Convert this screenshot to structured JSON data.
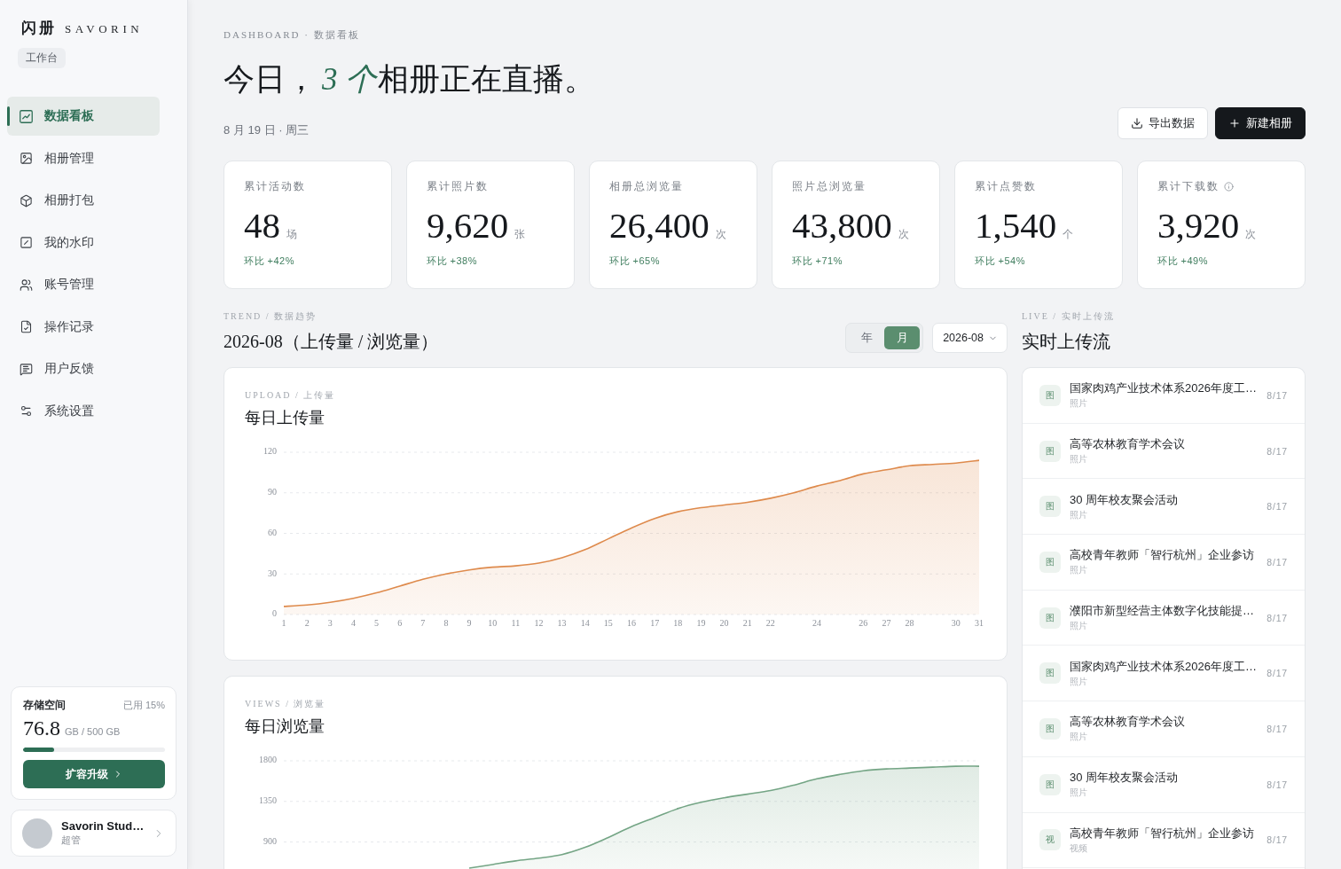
{
  "sidebar": {
    "brand": {
      "mark": "闪册",
      "name": "SAVORIN"
    },
    "workspace_tag": "工作台",
    "nav": [
      {
        "label": "数据看板",
        "selected": true
      },
      {
        "label": "相册管理",
        "selected": false
      },
      {
        "label": "相册打包",
        "selected": false
      },
      {
        "label": "我的水印",
        "selected": false
      },
      {
        "label": "账号管理",
        "selected": false
      },
      {
        "label": "操作记录",
        "selected": false
      },
      {
        "label": "用户反馈",
        "selected": false
      },
      {
        "label": "系统设置",
        "selected": false
      }
    ],
    "storage": {
      "title": "存储空间",
      "usage": "已用 15%",
      "amount": "76.8",
      "capacity": "GB / 500 GB",
      "level": 0.22,
      "button": "扩容升级"
    },
    "profile": {
      "name": "Savorin Stud…",
      "role": "超管"
    }
  },
  "header": {
    "breadcrumb": "DASHBOARD · 数据看板",
    "headline": {
      "lead": "今日，",
      "emphasis": "3 个",
      "tail": "相册正在直播。"
    },
    "date": "8 月 19 日 · 周三",
    "actions": [
      {
        "label": "导出数据",
        "kind": "secondary"
      },
      {
        "label": "新建相册",
        "kind": "primary"
      }
    ]
  },
  "stats": [
    {
      "label": "累计活动数",
      "value": "48",
      "unit": "场",
      "change": "环比 +42%",
      "info": false
    },
    {
      "label": "累计照片数",
      "value": "9,620",
      "unit": "张",
      "change": "环比 +38%",
      "info": false
    },
    {
      "label": "相册总浏览量",
      "value": "26,400",
      "unit": "次",
      "change": "环比 +65%",
      "info": false
    },
    {
      "label": "照片总浏览量",
      "value": "43,800",
      "unit": "次",
      "change": "环比 +71%",
      "info": false
    },
    {
      "label": "累计点赞数",
      "value": "1,540",
      "unit": "个",
      "change": "环比 +54%",
      "info": false
    },
    {
      "label": "累计下载数",
      "value": "3,920",
      "unit": "次",
      "change": "环比 +49%",
      "info": true
    }
  ],
  "trend": {
    "eyebrow": "TREND / 数据趋势",
    "title": "2026-08（上传量 / 浏览量）",
    "periods": [
      {
        "label": "年",
        "selected": false
      },
      {
        "label": "月",
        "selected": true
      }
    ],
    "month_select": "2026-08",
    "charts": [
      {
        "eyebrow": "UPLOAD / 上传量",
        "title": "每日上传量",
        "chart_data": {
          "type": "area",
          "x": [
            1,
            2,
            3,
            4,
            5,
            6,
            7,
            8,
            9,
            10,
            11,
            12,
            13,
            14,
            15,
            16,
            17,
            18,
            19,
            20,
            21,
            22,
            23,
            24,
            25,
            26,
            27,
            28,
            29,
            30,
            31
          ],
          "values": [
            6,
            7,
            9,
            12,
            16,
            21,
            26,
            30,
            33,
            35,
            36,
            38,
            42,
            48,
            56,
            64,
            71,
            76,
            79,
            81,
            83,
            86,
            90,
            95,
            99,
            104,
            107,
            110,
            111,
            112,
            114
          ],
          "xlim": [
            1,
            31
          ],
          "ylim": [
            0,
            120
          ],
          "xticks": [
            1,
            2,
            3,
            4,
            5,
            6,
            7,
            8,
            9,
            10,
            11,
            12,
            13,
            14,
            15,
            16,
            17,
            18,
            19,
            20,
            21,
            22,
            24,
            26,
            27,
            28,
            30,
            31
          ],
          "yticks": [
            0,
            30,
            60,
            90,
            120
          ],
          "grid": true
        }
      },
      {
        "eyebrow": "VIEWS / 浏览量",
        "title": "每日浏览量",
        "chart_data": {
          "type": "area",
          "x": [
            9,
            10,
            11,
            12,
            13,
            14,
            15,
            16,
            17,
            18,
            19,
            20,
            21,
            22,
            23,
            24,
            25,
            26,
            27,
            28,
            29,
            30,
            31
          ],
          "values": [
            610,
            650,
            690,
            720,
            760,
            840,
            950,
            1070,
            1170,
            1270,
            1340,
            1390,
            1430,
            1470,
            1530,
            1600,
            1650,
            1690,
            1710,
            1720,
            1730,
            1740,
            1740
          ],
          "xlim": [
            1,
            31
          ],
          "ylim": [
            0,
            1800
          ],
          "yticks": [
            900,
            1350,
            1800
          ],
          "grid": true
        }
      }
    ]
  },
  "live": {
    "eyebrow": "LIVE / 实时上传流",
    "title": "实时上传流",
    "items": [
      {
        "badge": "图",
        "title": "国家肉鸡产业技术体系2026年度工…",
        "type": "照片",
        "date": "8/17"
      },
      {
        "badge": "图",
        "title": "高等农林教育学术会议",
        "type": "照片",
        "date": "8/17"
      },
      {
        "badge": "图",
        "title": "30 周年校友聚会活动",
        "type": "照片",
        "date": "8/17"
      },
      {
        "badge": "图",
        "title": "高校青年教师「智行杭州」企业参访",
        "type": "照片",
        "date": "8/17"
      },
      {
        "badge": "图",
        "title": "濮阳市新型经营主体数字化技能提…",
        "type": "照片",
        "date": "8/17"
      },
      {
        "badge": "图",
        "title": "国家肉鸡产业技术体系2026年度工…",
        "type": "照片",
        "date": "8/17"
      },
      {
        "badge": "图",
        "title": "高等农林教育学术会议",
        "type": "照片",
        "date": "8/17"
      },
      {
        "badge": "图",
        "title": "30 周年校友聚会活动",
        "type": "照片",
        "date": "8/17"
      },
      {
        "badge": "视",
        "title": "高校青年教师「智行杭州」企业参访",
        "type": "视频",
        "date": "8/17"
      }
    ]
  }
}
